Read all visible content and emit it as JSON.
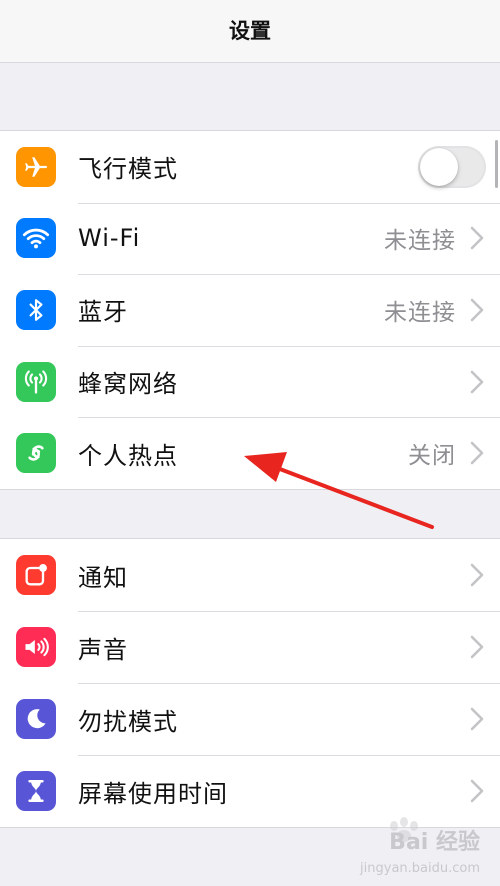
{
  "nav": {
    "title": "设置"
  },
  "colors": {
    "airplane": "#ff9500",
    "wifi": "#007aff",
    "bluetooth": "#007aff",
    "cellular": "#34c759",
    "hotspot": "#34c759",
    "notifications": "#ff3b30",
    "sounds": "#ff2d55",
    "do_not_disturb": "#5856d6",
    "screen_time": "#5856d6",
    "annotation_arrow": "#e8261f"
  },
  "group1": {
    "rows": [
      {
        "label": "飞行模式",
        "icon": "airplane-icon",
        "toggle_on": false
      },
      {
        "label": "Wi-Fi",
        "icon": "wifi-icon",
        "value": "未连接"
      },
      {
        "label": "蓝牙",
        "icon": "bluetooth-icon",
        "value": "未连接"
      },
      {
        "label": "蜂窝网络",
        "icon": "cellular-antenna-icon"
      },
      {
        "label": "个人热点",
        "icon": "hotspot-link-icon",
        "value": "关闭"
      }
    ]
  },
  "group2": {
    "rows": [
      {
        "label": "通知",
        "icon": "notifications-icon"
      },
      {
        "label": "声音",
        "icon": "speaker-icon"
      },
      {
        "label": "勿扰模式",
        "icon": "moon-icon"
      },
      {
        "label": "屏幕使用时间",
        "icon": "hourglass-icon"
      }
    ]
  },
  "watermark": {
    "text": "Bai 经验",
    "sub": "jingyan.baidu.com"
  }
}
